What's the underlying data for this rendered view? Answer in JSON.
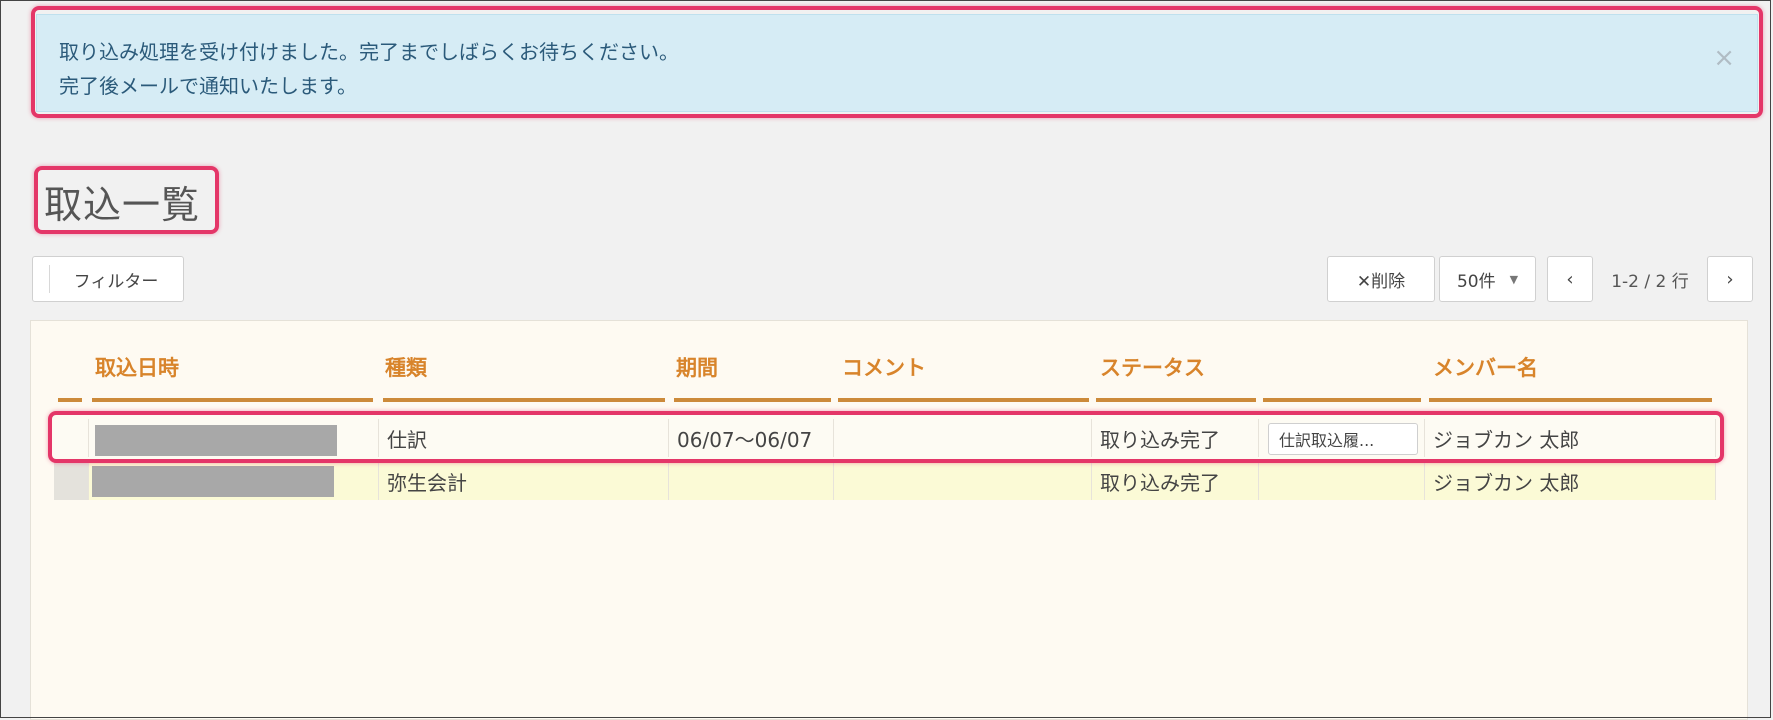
{
  "alert": {
    "line1": "取り込み処理を受け付けました。完了までしばらくお待ちください。",
    "line2": "完了後メールで通知いたします。",
    "close_glyph": "×"
  },
  "page": {
    "title": "取込一覧"
  },
  "toolbar": {
    "filter_label": "フィルター",
    "delete_label": "✕削除",
    "per_page": "50件",
    "caret": "▼",
    "prev_glyph": "‹",
    "next_glyph": "›",
    "row_range": "1-2 / 2 行"
  },
  "table": {
    "headers": [
      "取込日時",
      "種類",
      "期間",
      "コメント",
      "ステータス",
      "",
      "メンバー名"
    ],
    "rows": [
      {
        "type": "仕訳",
        "period": "06/07～06/07",
        "comment": "",
        "status": "取り込み完了",
        "action": "仕訳取込履...",
        "member": "ジョブカン 太郎"
      },
      {
        "type": "弥生会計",
        "period": "",
        "comment": "",
        "status": "取り込み完了",
        "action": "",
        "member": "ジョブカン 太郎"
      }
    ]
  },
  "colors": {
    "highlight": "#e43668",
    "header_text": "#d8842b",
    "alert_bg": "#d6ecf5"
  }
}
